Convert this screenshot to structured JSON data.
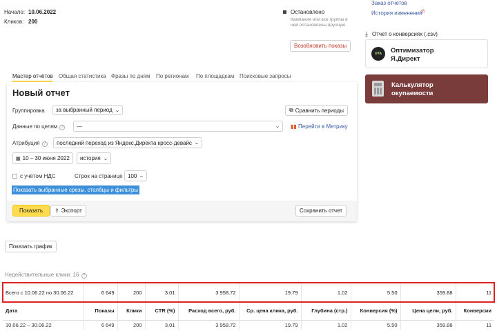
{
  "summary": {
    "start_label": "Начало:",
    "start_value": "10.06.2022",
    "clicks_label": "Кликов:",
    "clicks_value": "200"
  },
  "status": {
    "title": "Остановлено",
    "note": "Кампания или все группы в ней остановлены вручную",
    "resume_button": "Возобновить показы"
  },
  "right_links": {
    "orders": "Заказ отчетов",
    "history": "История изменений",
    "history_badge": "β",
    "conversions": "Отчет о конверсиях (.csv)"
  },
  "promo_optimizer": {
    "badge": "UTA",
    "line1": "Оптимизатор",
    "line2": "Я.Директ"
  },
  "promo_calculator": {
    "line1": "Калькулятор",
    "line2": "окупаемости",
    "bg": "#7a3b3b"
  },
  "tabs": [
    "Мастер отчётов",
    "Общая статистика",
    "Фразы по дням",
    "По регионам",
    "По площадкам",
    "Поисковые запросы"
  ],
  "report": {
    "title": "Новый отчет",
    "grouping_label": "Группировка",
    "grouping_value": "за выбранный период",
    "compare_button": "Сравнить периоды",
    "goals_label": "Данные по целям",
    "goals_value": "—",
    "metrika_link": "Перейти в Метрику",
    "attribution_label": "Атрибуция",
    "attribution_value": "последний переход из Яндекс.Директа кросс-девайс",
    "date_range": "10 – 30 июня 2022",
    "history_value": "история",
    "vat_label": "с учётом НДС",
    "rows_label": "Строк на странице",
    "rows_value": "100",
    "show_selected": "Показать выбранные срезы, столбцы и фильтры",
    "show_button": "Показать",
    "export_button": "Экспорт",
    "save_button": "Сохранить отчет"
  },
  "graph_button": "Показать график",
  "invalid_clicks": "Недействительные клики: 16",
  "table": {
    "total_row": [
      "Всего с 10.06.22 по 30.06.22",
      "6 649",
      "200",
      "3.01",
      "3 958.72",
      "19.79",
      "1.02",
      "5.50",
      "359.88",
      "11"
    ],
    "headers": [
      "Дата",
      "Показы",
      "Клики",
      "CTR (%)",
      "Расход всего, руб.",
      "Ср. цена клика, руб.",
      "Глубина (стр.)",
      "Конверсия (%)",
      "Цена цели, руб.",
      "Конверсии"
    ],
    "first_row": [
      "10.06.22 – 30.06.22",
      "6 649",
      "200",
      "3.01",
      "3 958.72",
      "19.79",
      "1.02",
      "5.50",
      "359.88",
      "11"
    ]
  },
  "colors": {
    "accent_yellow": "#ffdb4d",
    "highlight_red": "#e02020",
    "selection_blue": "#3d8fd9",
    "link_blue": "#3a5ba0"
  }
}
